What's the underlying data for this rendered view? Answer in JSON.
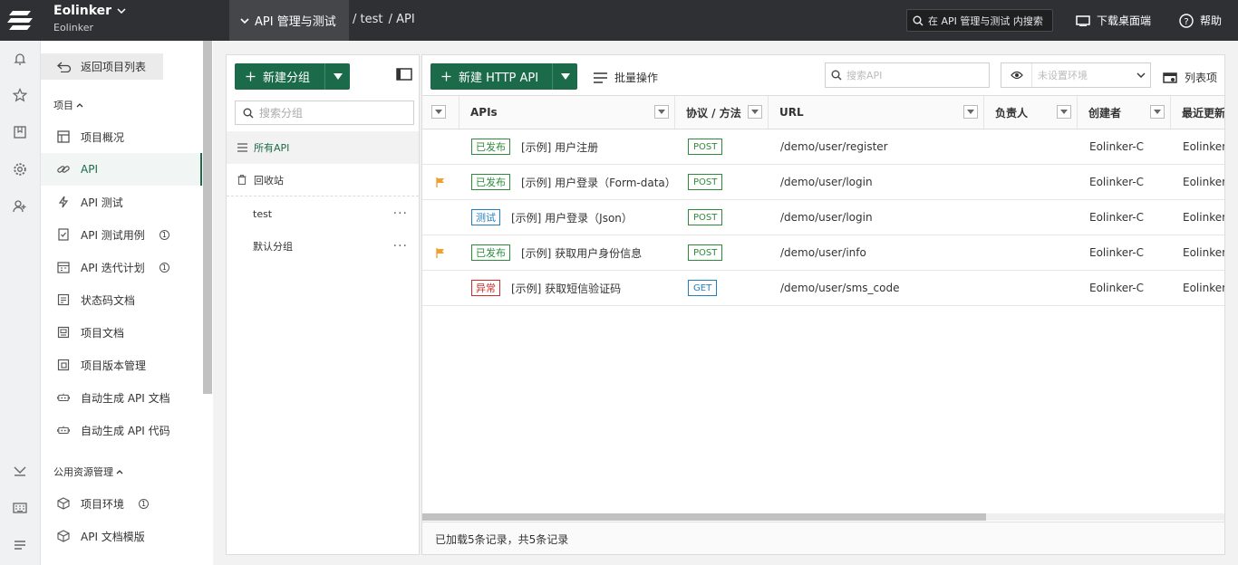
{
  "topbar": {
    "brand_name": "Eolinker",
    "brand_sub": "Eolinker",
    "module": "API 管理与测试",
    "breadcrumb": [
      "/ test",
      "/ API"
    ],
    "search_placeholder": "在 API 管理与测试 内搜索",
    "download": "下载桌面端",
    "help": "帮助"
  },
  "sidebar": {
    "back": "返回项目列表",
    "section_project": "项目",
    "items": [
      {
        "label": "项目概况",
        "icon": "dashboard-icon"
      },
      {
        "label": "API",
        "icon": "link-icon"
      },
      {
        "label": "API 测试",
        "icon": "lightning-icon"
      },
      {
        "label": "API 测试用例",
        "icon": "checklist-icon"
      },
      {
        "label": "API 迭代计划",
        "icon": "calendar-icon"
      },
      {
        "label": "状态码文档",
        "icon": "document-icon"
      },
      {
        "label": "项目文档",
        "icon": "book-icon"
      },
      {
        "label": "项目版本管理",
        "icon": "version-icon"
      },
      {
        "label": "自动生成 API 文档",
        "icon": "robot-icon"
      },
      {
        "label": "自动生成 API 代码",
        "icon": "robot-icon"
      }
    ],
    "section_public": "公用资源管理",
    "public_items": [
      {
        "label": "项目环境",
        "icon": "cube-icon"
      },
      {
        "label": "API 文档模版",
        "icon": "cube-icon"
      }
    ]
  },
  "groups": {
    "new_group": "新建分组",
    "search_placeholder": "搜索分组",
    "items": [
      "所有API",
      "回收站",
      "test",
      "默认分组"
    ]
  },
  "main": {
    "new_api": "新建 HTTP API",
    "batch": "批量操作",
    "search_placeholder": "搜索API",
    "env_placeholder": "未设置环境",
    "columns_button": "列表项",
    "columns": [
      "APIs",
      "协议 / 方法",
      "URL",
      "负责人",
      "创建者",
      "最近更新"
    ],
    "rows": [
      {
        "flag": false,
        "status": "已发布",
        "status_color": "#2e8b3a",
        "name": "[示例] 用户注册",
        "method": "POST",
        "method_color": "#2e8b3a",
        "url": "/demo/user/register",
        "owner": "",
        "creator": "Eolinker-C",
        "updater": "Eolinker-"
      },
      {
        "flag": true,
        "status": "已发布",
        "status_color": "#2e8b3a",
        "name": "[示例] 用户登录（Form-data）",
        "method": "POST",
        "method_color": "#2e8b3a",
        "url": "/demo/user/login",
        "owner": "",
        "creator": "Eolinker-C",
        "updater": "Eolinker-"
      },
      {
        "flag": false,
        "status": "测试",
        "status_color": "#1f7ec4",
        "name": "[示例] 用户登录（Json）",
        "method": "POST",
        "method_color": "#2e8b3a",
        "url": "/demo/user/login",
        "owner": "",
        "creator": "Eolinker-C",
        "updater": "Eolinker-"
      },
      {
        "flag": true,
        "status": "已发布",
        "status_color": "#2e8b3a",
        "name": "[示例] 获取用户身份信息",
        "method": "POST",
        "method_color": "#2e8b3a",
        "url": "/demo/user/info",
        "owner": "",
        "creator": "Eolinker-C",
        "updater": "Eolinker-"
      },
      {
        "flag": false,
        "status": "异常",
        "status_color": "#c9302c",
        "name": "[示例] 获取短信验证码",
        "method": "GET",
        "method_color": "#1f7ec4",
        "url": "/demo/user/sms_code",
        "owner": "",
        "creator": "Eolinker-C",
        "updater": "Eolinker-"
      }
    ],
    "footer": "已加载5条记录，共5条记录"
  },
  "colors": {
    "accent": "#1b6b4a",
    "topbar": "#2f3033",
    "flag": "#f0a030"
  }
}
